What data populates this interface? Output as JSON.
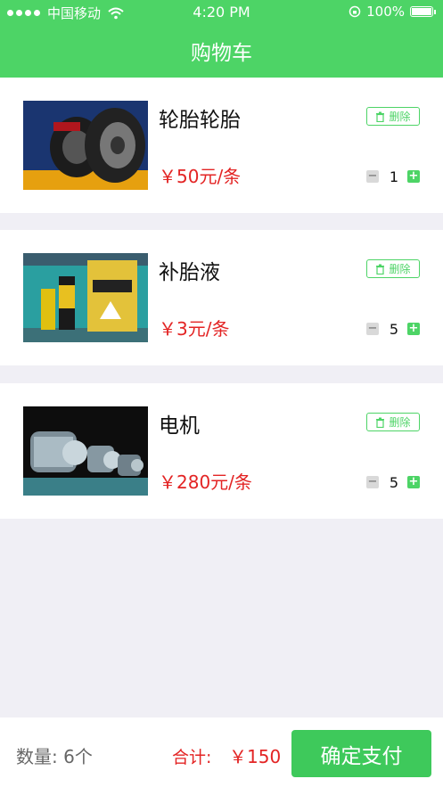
{
  "status_bar": {
    "carrier": "中国移动",
    "time": "4:20 PM",
    "battery": "100%"
  },
  "header": {
    "title": "购物车"
  },
  "colors": {
    "brand_green": "#4dd466",
    "price_red": "#e32424"
  },
  "cart": {
    "delete_label": "删除",
    "items": [
      {
        "name": "轮胎轮胎",
        "price": "￥50元/条",
        "quantity": "1",
        "image": "tire-image"
      },
      {
        "name": "补胎液",
        "price": "￥3元/条",
        "quantity": "5",
        "image": "tire-sealer-image"
      },
      {
        "name": "电机",
        "price": "￥280元/条",
        "quantity": "5",
        "image": "motor-image"
      }
    ]
  },
  "footer": {
    "count_label": "数量: 6个",
    "total_label": "合计:",
    "total_value": "￥150",
    "pay_label": "确定支付"
  }
}
